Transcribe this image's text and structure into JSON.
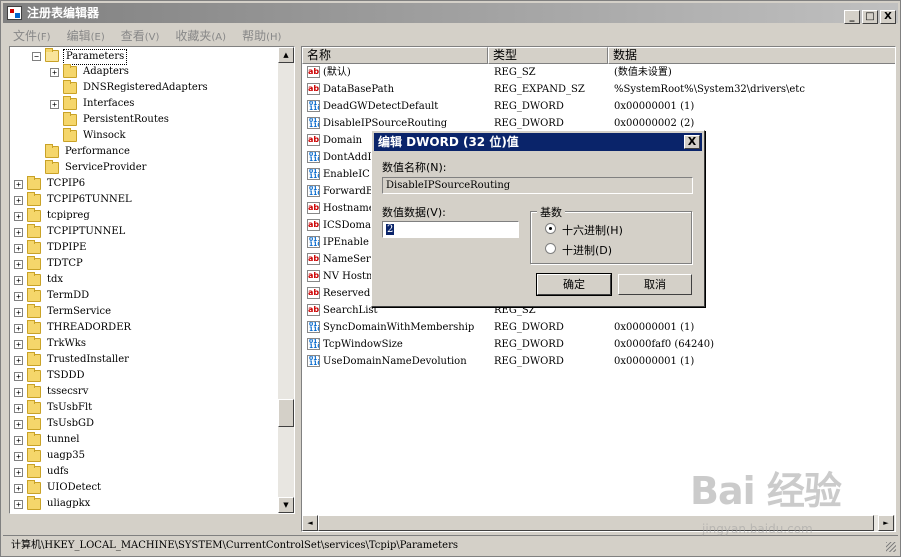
{
  "window": {
    "title": "注册表编辑器",
    "btn_min": "_",
    "btn_max": "□",
    "btn_close": "X"
  },
  "menu": [
    {
      "label": "文件",
      "accel": "(F)"
    },
    {
      "label": "编辑",
      "accel": "(E)"
    },
    {
      "label": "查看",
      "accel": "(V)"
    },
    {
      "label": "收藏夹",
      "accel": "(A)"
    },
    {
      "label": "帮助",
      "accel": "(H)"
    }
  ],
  "tree": {
    "items": [
      {
        "label": "Parameters",
        "expander": "−",
        "selected": true,
        "open": true
      },
      {
        "label": "Adapters",
        "expander": "+"
      },
      {
        "label": "DNSRegisteredAdapters",
        "expander": ""
      },
      {
        "label": "Interfaces",
        "expander": "+"
      },
      {
        "label": "PersistentRoutes",
        "expander": ""
      },
      {
        "label": "Winsock",
        "expander": ""
      },
      {
        "label": "Performance",
        "expander": ""
      },
      {
        "label": "ServiceProvider",
        "expander": ""
      },
      {
        "label": "TCPIP6",
        "expander": "+"
      },
      {
        "label": "TCPIP6TUNNEL",
        "expander": "+"
      },
      {
        "label": "tcpipreg",
        "expander": "+"
      },
      {
        "label": "TCPIPTUNNEL",
        "expander": "+"
      },
      {
        "label": "TDPIPE",
        "expander": "+"
      },
      {
        "label": "TDTCP",
        "expander": "+"
      },
      {
        "label": "tdx",
        "expander": "+"
      },
      {
        "label": "TermDD",
        "expander": "+"
      },
      {
        "label": "TermService",
        "expander": "+"
      },
      {
        "label": "THREADORDER",
        "expander": "+"
      },
      {
        "label": "TrkWks",
        "expander": "+"
      },
      {
        "label": "TrustedInstaller",
        "expander": "+"
      },
      {
        "label": "TSDDD",
        "expander": "+"
      },
      {
        "label": "tssecsrv",
        "expander": "+"
      },
      {
        "label": "TsUsbFlt",
        "expander": "+"
      },
      {
        "label": "TsUsbGD",
        "expander": "+"
      },
      {
        "label": "tunnel",
        "expander": "+"
      },
      {
        "label": "uagp35",
        "expander": "+"
      },
      {
        "label": "udfs",
        "expander": "+"
      },
      {
        "label": "UIODetect",
        "expander": "+"
      },
      {
        "label": "uliagpkx",
        "expander": "+"
      }
    ],
    "scroll_up": "▲",
    "scroll_down": "▼"
  },
  "list": {
    "columns": [
      "名称",
      "类型",
      "数据"
    ],
    "rows": [
      {
        "icon": "ab",
        "name": "(默认)",
        "type": "REG_SZ",
        "data": "(数值未设置)"
      },
      {
        "icon": "ab",
        "name": "DataBasePath",
        "type": "REG_EXPAND_SZ",
        "data": "%SystemRoot%\\System32\\drivers\\etc"
      },
      {
        "icon": "bin",
        "name": "DeadGWDetectDefault",
        "type": "REG_DWORD",
        "data": "0x00000001 (1)"
      },
      {
        "icon": "bin",
        "name": "DisableIPSourceRouting",
        "type": "REG_DWORD",
        "data": "0x00000002 (2)"
      },
      {
        "icon": "ab",
        "name": "Domain",
        "type": "",
        "data": ""
      },
      {
        "icon": "bin",
        "name": "DontAddD",
        "type": "",
        "data": ""
      },
      {
        "icon": "bin",
        "name": "EnableIC",
        "type": "",
        "data": ""
      },
      {
        "icon": "bin",
        "name": "ForwardB",
        "type": "",
        "data": ""
      },
      {
        "icon": "ab",
        "name": "Hostname",
        "type": "",
        "data": ""
      },
      {
        "icon": "ab",
        "name": "ICSDomai",
        "type": "",
        "data": ""
      },
      {
        "icon": "bin",
        "name": "IPEnable",
        "type": "",
        "data": ""
      },
      {
        "icon": "ab",
        "name": "NameServ",
        "type": "",
        "data": ""
      },
      {
        "icon": "ab",
        "name": "NV Hostn",
        "type": "",
        "data": ""
      },
      {
        "icon": "ab",
        "name": "Reserved",
        "type": "",
        "data": ""
      },
      {
        "icon": "ab",
        "name": "SearchList",
        "type": "REG_SZ",
        "data": ""
      },
      {
        "icon": "bin",
        "name": "SyncDomainWithMembership",
        "type": "REG_DWORD",
        "data": "0x00000001 (1)"
      },
      {
        "icon": "bin",
        "name": "TcpWindowSize",
        "type": "REG_DWORD",
        "data": "0x0000faf0 (64240)"
      },
      {
        "icon": "bin",
        "name": "UseDomainNameDevolution",
        "type": "REG_DWORD",
        "data": "0x00000001 (1)"
      }
    ],
    "scroll_left": "◄",
    "scroll_right": "►"
  },
  "icons": {
    "ab": "ab",
    "bin": "011\n110"
  },
  "status": {
    "path": "计算机\\HKEY_LOCAL_MACHINE\\SYSTEM\\CurrentControlSet\\services\\Tcpip\\Parameters"
  },
  "dialog": {
    "title": "编辑 DWORD (32 位)值",
    "close": "X",
    "name_label": "数值名称(N):",
    "name_value": "DisableIPSourceRouting",
    "data_label": "数值数据(V):",
    "data_value": "2",
    "base_label": "基数",
    "radio_hex": "十六进制(H)",
    "radio_dec": "十进制(D)",
    "ok": "确定",
    "cancel": "取消"
  },
  "watermark": {
    "big": "Bai 经验",
    "small": "jingyan.baidu.com"
  },
  "colors": {
    "selection": "#0a246a",
    "folder": "#f5d66b",
    "face": "#d4d0c8"
  }
}
